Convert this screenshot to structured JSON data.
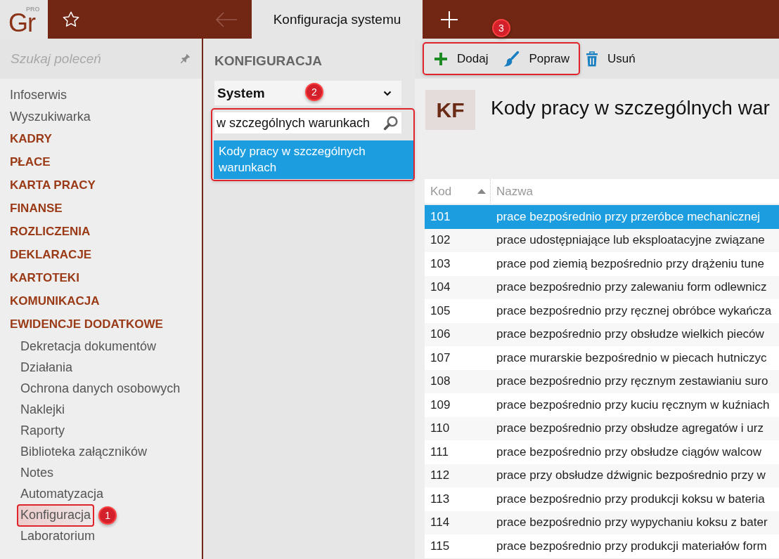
{
  "logo": {
    "text": "Gr",
    "badge": "PRO"
  },
  "back_button": {
    "disabled": true
  },
  "tabs": [
    {
      "label": "Konfiguracja systemu",
      "selected": true
    }
  ],
  "sidebar": {
    "search": {
      "placeholder": "Szukaj poleceń"
    },
    "items": [
      {
        "label": "Infoserwis",
        "kind": "link"
      },
      {
        "label": "Wyszukiwarka",
        "kind": "link"
      },
      {
        "label": "KADRY",
        "kind": "section"
      },
      {
        "label": "PŁACE",
        "kind": "section"
      },
      {
        "label": "KARTA PRACY",
        "kind": "section"
      },
      {
        "label": "FINANSE",
        "kind": "section"
      },
      {
        "label": "ROZLICZENIA",
        "kind": "section"
      },
      {
        "label": "DEKLARACJE",
        "kind": "section"
      },
      {
        "label": "KARTOTEKI",
        "kind": "section"
      },
      {
        "label": "KOMUNIKACJA",
        "kind": "section"
      },
      {
        "label": "EWIDENCJE DODATKOWE",
        "kind": "section",
        "children": [
          {
            "label": "Dekretacja dokumentów",
            "selected": false
          },
          {
            "label": "Działania",
            "selected": false
          },
          {
            "label": "Ochrona danych osobowych",
            "selected": false
          },
          {
            "label": "Naklejki",
            "selected": false
          },
          {
            "label": "Raporty",
            "selected": false
          },
          {
            "label": "Biblioteka załączników",
            "selected": false
          },
          {
            "label": "Notes",
            "selected": false
          },
          {
            "label": "Automatyzacja",
            "selected": false
          },
          {
            "label": "Konfiguracja",
            "selected": true,
            "callout": "1"
          },
          {
            "label": "Laboratorium",
            "selected": false
          }
        ]
      }
    ]
  },
  "config_panel": {
    "heading": "KONFIGURACJA",
    "dropdown": {
      "value": "System"
    },
    "finder": {
      "callout": "2",
      "search": {
        "value": "w szczególnych warunkach"
      },
      "results": [
        {
          "label": "Kody pracy w szczególnych warunkach",
          "selected": true
        }
      ]
    }
  },
  "toolbar": {
    "groups": [
      {
        "callout": "3",
        "buttons": [
          {
            "label": "Dodaj",
            "kind": "add"
          },
          {
            "label": "Popraw",
            "kind": "edit"
          }
        ]
      },
      {
        "buttons": [
          {
            "label": "Usuń",
            "kind": "delete"
          }
        ]
      }
    ]
  },
  "record": {
    "initials": "KF",
    "title": "Kody pracy w szczególnych war"
  },
  "table": {
    "columns": [
      {
        "label": "Kod",
        "sorted": true
      },
      {
        "label": "Nazwa",
        "sorted": false
      }
    ],
    "rows": [
      {
        "cells": [
          "101",
          "prace bezpośrednio przy przeróbce mechanicznej"
        ],
        "selected": true
      },
      {
        "cells": [
          "102",
          "prace udostępniające lub eksploatacyjne związane"
        ],
        "selected": false
      },
      {
        "cells": [
          "103",
          "prace pod ziemią bezpośrednio przy drążeniu tune"
        ],
        "selected": false
      },
      {
        "cells": [
          "104",
          "prace bezpośrednio przy zalewaniu form odlewnicz"
        ],
        "selected": false
      },
      {
        "cells": [
          "105",
          "prace bezpośrednio przy ręcznej obróbce wykańcza"
        ],
        "selected": false
      },
      {
        "cells": [
          "106",
          "prace bezpośrednio przy obsłudze wielkich pieców"
        ],
        "selected": false
      },
      {
        "cells": [
          "107",
          "prace murarskie bezpośrednio w piecach hutniczyc"
        ],
        "selected": false
      },
      {
        "cells": [
          "108",
          "prace bezpośrednio przy ręcznym zestawianiu suro"
        ],
        "selected": false
      },
      {
        "cells": [
          "109",
          "prace bezpośrednio przy kuciu ręcznym w kuźniach"
        ],
        "selected": false
      },
      {
        "cells": [
          "110",
          "prace bezpośrednio przy obsłudze agregatów i urz"
        ],
        "selected": false
      },
      {
        "cells": [
          "111",
          "prace bezpośrednio przy obsłudze ciągów walcow"
        ],
        "selected": false
      },
      {
        "cells": [
          "112",
          "prace przy obsłudze dźwignic bezpośrednio przy w"
        ],
        "selected": false
      },
      {
        "cells": [
          "113",
          "prace bezpośrednio przy produkcji koksu w bateria"
        ],
        "selected": false
      },
      {
        "cells": [
          "114",
          "prace bezpośrednio przy wypychaniu koksu z bater"
        ],
        "selected": false
      },
      {
        "cells": [
          "115",
          "prace bezpośrednio przy produkcji materiałów form"
        ],
        "selected": false
      }
    ]
  }
}
